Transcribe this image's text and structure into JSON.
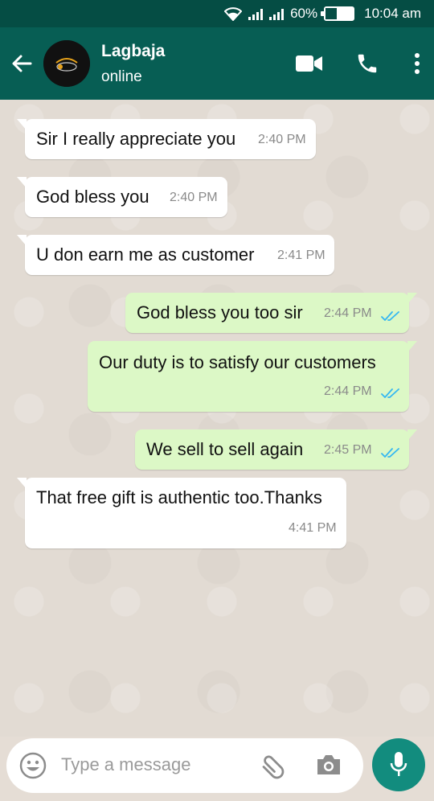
{
  "status_bar": {
    "battery": "60%",
    "time": "10:04 am",
    "battery_level": 0.6
  },
  "header": {
    "contact_name": "Lagbaja",
    "contact_status": "online"
  },
  "icons": {
    "back": "arrow-back-icon",
    "video": "video-call-icon",
    "call": "phone-icon",
    "menu": "more-vert-icon",
    "emoji": "emoji-icon",
    "attach": "paperclip-icon",
    "camera": "camera-icon",
    "mic": "mic-icon"
  },
  "messages": [
    {
      "direction": "in",
      "text": "Sir I really appreciate you",
      "time": "2:40 PM"
    },
    {
      "direction": "in",
      "text": "God bless you",
      "time": "2:40 PM"
    },
    {
      "direction": "in",
      "text": "U don earn me as customer",
      "time": "2:41 PM"
    },
    {
      "direction": "out",
      "text": "God bless you too sir",
      "time": "2:44 PM",
      "status": "read"
    },
    {
      "direction": "out",
      "text": "Our duty is to satisfy our customers",
      "time": "2:44 PM",
      "status": "read"
    },
    {
      "direction": "out",
      "text": "We sell to sell again",
      "time": "2:45 PM",
      "status": "read"
    },
    {
      "direction": "in",
      "text": "That free gift is authentic too.Thanks",
      "time": "4:41 PM"
    }
  ],
  "composer": {
    "placeholder": "Type a message"
  },
  "colors": {
    "header": "#075e54",
    "status_bar": "#054d44",
    "outgoing_bubble": "#dcf8c6",
    "incoming_bubble": "#ffffff",
    "accent": "#128c7e",
    "read_ticks": "#34b7f1"
  }
}
